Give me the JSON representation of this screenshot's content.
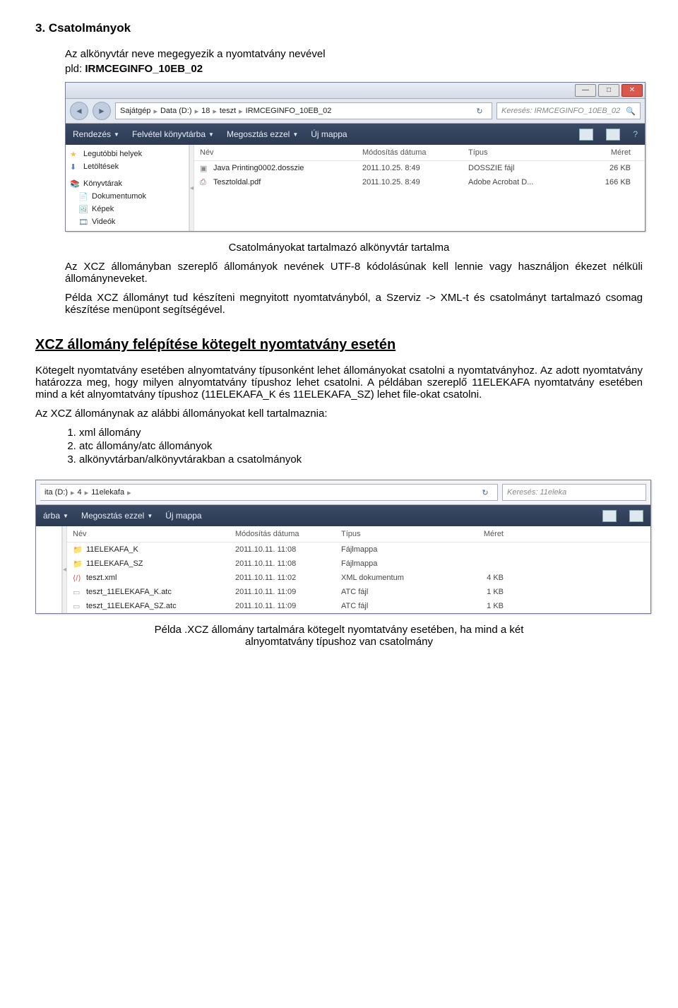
{
  "doc": {
    "h3": "3. Csatolmányok",
    "intro1": "Az alkönyvtár neve megegyezik a nyomtatvány nevével",
    "intro2_prefix": "pld: ",
    "intro2_bold": "IRMCEGINFO_10EB_02",
    "caption1": "Csatolmányokat tartalmazó alkönyvtár tartalma",
    "para1": "Az XCZ állományban szereplő állományok nevének UTF-8 kódolásúnak kell lennie vagy használjon ékezet nélküli állományneveket.",
    "para2": "Példa XCZ állományt tud készíteni megnyitott nyomtatványból, a Szerviz -> XML-t és csatolmányt tartalmazó csomag készítése menüpont segítségével.",
    "h_section2": "XCZ állomány felépítése kötegelt nyomtatvány esetén",
    "para3": "Kötegelt nyomtatvány esetében alnyomtatvány típusonként lehet állományokat csatolni a nyomtatványhoz. Az adott nyomtatvány határozza meg, hogy milyen alnyomtatvány típushoz lehet csatolni. A példában szereplő 11ELEKAFA nyomtatvány esetében mind a két alnyomtatvány típushoz (11ELEKAFA_K és 11ELEKAFA_SZ) lehet file-okat csatolni.",
    "para4": "Az XCZ állománynak az alábbi állományokat kell tartalmaznia:",
    "list_items": [
      "xml állomány",
      "atc állomány/atc állományok",
      "alkönyvtárban/alkönyvtárakban a csatolmányok"
    ],
    "caption2a": "Példa .XCZ állomány tartalmára kötegelt nyomtatvány esetében, ha mind a két",
    "caption2b": "alnyomtatvány típushoz van csatolmány"
  },
  "win1": {
    "crumbs": [
      "Sajátgép",
      "Data (D:)",
      "18",
      "teszt",
      "IRMCEGINFO_10EB_02"
    ],
    "search_placeholder": "Keresés: IRMCEGINFO_10EB_02",
    "toolbar": {
      "rendezes": "Rendezés",
      "felvetel": "Felvétel könyvtárba",
      "megosztas": "Megosztás ezzel",
      "uj": "Új mappa"
    },
    "nav": {
      "legutobbi": "Legutóbbi helyek",
      "letoltesek": "Letöltések",
      "konyvtarak": "Könyvtárak",
      "dokumentumok": "Dokumentumok",
      "kepek": "Képek",
      "videok": "Videók"
    },
    "cols": {
      "nev": "Név",
      "mod": "Módosítás dátuma",
      "tip": "Típus",
      "mer": "Méret"
    },
    "rows": [
      {
        "name": "Java Printing0002.dosszie",
        "mod": "2011.10.25. 8:49",
        "tip": "DOSSZIE fájl",
        "mer": "26 KB",
        "ic": "dossz"
      },
      {
        "name": "Tesztoldal.pdf",
        "mod": "2011.10.25. 8:49",
        "tip": "Adobe Acrobat D...",
        "mer": "166 KB",
        "ic": "pdf"
      }
    ]
  },
  "win2": {
    "crumbs": [
      "ita (D:)",
      "4",
      "11elekafa"
    ],
    "search_placeholder": "Keresés: 11eleka",
    "toolbar": {
      "arba": "árba",
      "megosztas": "Megosztás ezzel",
      "uj": "Új mappa"
    },
    "cols": {
      "nev": "Név",
      "mod": "Módosítás dátuma",
      "tip": "Típus",
      "mer": "Méret"
    },
    "rows": [
      {
        "name": "11ELEKAFA_K",
        "mod": "2011.10.11. 11:08",
        "tip": "Fájlmappa",
        "mer": "",
        "ic": "folder"
      },
      {
        "name": "11ELEKAFA_SZ",
        "mod": "2011.10.11. 11:08",
        "tip": "Fájlmappa",
        "mer": "",
        "ic": "folder"
      },
      {
        "name": "teszt.xml",
        "mod": "2011.10.11. 11:02",
        "tip": "XML dokumentum",
        "mer": "4 KB",
        "ic": "xml"
      },
      {
        "name": "teszt_11ELEKAFA_K.atc",
        "mod": "2011.10.11. 11:09",
        "tip": "ATC fájl",
        "mer": "1 KB",
        "ic": "atc"
      },
      {
        "name": "teszt_11ELEKAFA_SZ.atc",
        "mod": "2011.10.11. 11:09",
        "tip": "ATC fájl",
        "mer": "1 KB",
        "ic": "atc"
      }
    ]
  }
}
